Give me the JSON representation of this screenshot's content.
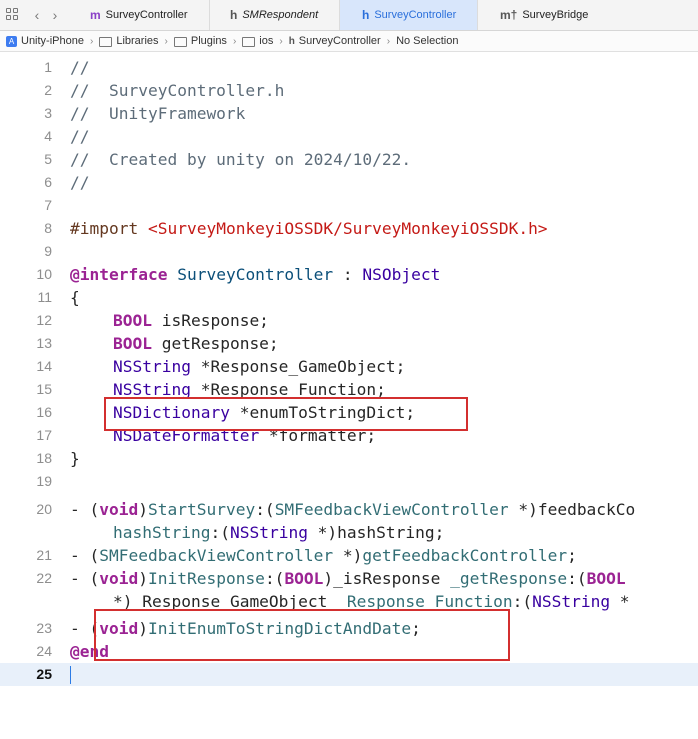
{
  "tabs": [
    {
      "icon": "m",
      "label": "SurveyController",
      "active": false,
      "italic": false
    },
    {
      "icon": "h",
      "label": "SMRespondent",
      "active": false,
      "italic": true
    },
    {
      "icon": "h",
      "label": "SurveyController",
      "active": true,
      "italic": false
    },
    {
      "icon": "m†",
      "label": "SurveyBridge",
      "active": false,
      "italic": false
    }
  ],
  "breadcrumb": [
    "Unity-iPhone",
    "Libraries",
    "Plugins",
    "ios",
    "SurveyController",
    "No Selection"
  ],
  "line_numbers": [
    "1",
    "2",
    "3",
    "4",
    "5",
    "6",
    "7",
    "8",
    "9",
    "10",
    "11",
    "12",
    "13",
    "14",
    "15",
    "16",
    "17",
    "18",
    "19",
    "20",
    "21",
    "22",
    "23",
    "24",
    "25"
  ],
  "code": {
    "l1": "//",
    "l2": "//  SurveyController.h",
    "l3": "//  UnityFramework",
    "l4": "//",
    "l5": "//  Created by unity on 2024/10/22.",
    "l6": "//",
    "l8_kw": "#import",
    "l8_str": "<SurveyMonkeyiOSSDK/SurveyMonkeyiOSSDK.h>",
    "l10_kw": "@interface",
    "l10_name": "SurveyController",
    "l10_colon": " : ",
    "l10_super": "NSObject",
    "l11": "{",
    "l12_type": "BOOL",
    "l12_rest": " isResponse;",
    "l13_type": "BOOL",
    "l13_rest": " getResponse;",
    "l14_type": "NSString",
    "l14_rest": " *Response_GameObject;",
    "l15_type": "NSString",
    "l15_rest": " *Response_Function;",
    "l16_type": "NSDictionary",
    "l16_rest": " *enumToStringDict;",
    "l17_type": "NSDateFormatter",
    "l17_rest": " *formatter;",
    "l18": "}",
    "l20_a": "- (",
    "l20_void": "void",
    "l20_b": ")",
    "l20_fn": "StartSurvey",
    "l20_c": ":(",
    "l20_type": "SMFeedbackViewController",
    "l20_d": " *)feedbackCo",
    "l20w_fn": "hashString",
    "l20w_a": ":(",
    "l20w_type": "NSString",
    "l20w_b": " *)hashString;",
    "l21_a": "- (",
    "l21_type": "SMFeedbackViewController",
    "l21_b": " *)",
    "l21_fn": "getFeedbackController",
    "l21_c": ";",
    "l22_a": "- (",
    "l22_void": "void",
    "l22_b": ")",
    "l22_fn": "InitResponse",
    "l22_c": ":(",
    "l22_bool": "BOOL",
    "l22_d": ")_isResponse ",
    "l22_fn2": "_getResponse",
    "l22_e": ":(",
    "l22_bool2": "BOOL",
    "l22w_a": "*)_Response_GameObject ",
    "l22w_fn": "_Response_Function",
    "l22w_b": ":(",
    "l22w_type": "NSString",
    "l22w_c": " *",
    "l23_a": "- (",
    "l23_void": "void",
    "l23_b": ")",
    "l23_fn": "InitEnumToStringDictAndDate",
    "l23_c": ";",
    "l24": "@end"
  },
  "colors": {
    "comment": "#5d6c79",
    "keyword": "#9b2393",
    "type": "#0b4f79",
    "system_type": "#3900a0",
    "function": "#326d74",
    "string": "#c41a16",
    "highlight_box": "#d32f2f",
    "active_tab": "#2a6fdb"
  }
}
